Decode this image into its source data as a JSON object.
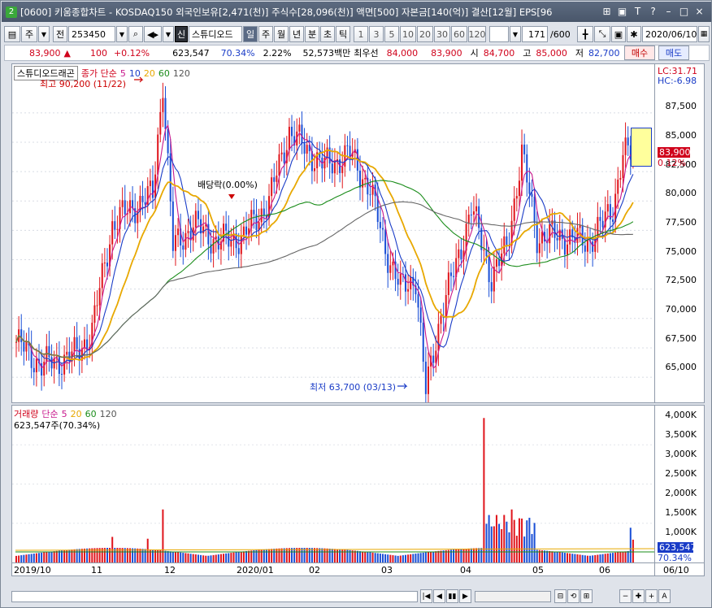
{
  "window": {
    "title": "[0600] 키움종합차트 - KOSDAQ150 외국인보유[2,471(천)] 주식수[28,096(천)] 액면[500] 자본금[140(억)] 결산[12월] EPS[96",
    "badge": "2",
    "controls": [
      "⊞",
      "▣",
      "T",
      "?",
      "–",
      "□",
      "×"
    ]
  },
  "toolbar": {
    "period_label": "주",
    "prev_label": "전",
    "code": "253450",
    "shin_label": "신",
    "stock_name": "스튜디오드",
    "tf_buttons": [
      "일",
      "주",
      "월",
      "년",
      "분",
      "초",
      "틱"
    ],
    "tf_active": "일",
    "nums": [
      "1",
      "3",
      "5",
      "10",
      "20",
      "30",
      "60",
      "120"
    ],
    "count": "171",
    "count_total": "/600",
    "date": "2020/06/10"
  },
  "quote": {
    "price": "83,900",
    "change": "100",
    "change_pct": "+0.12%",
    "volume": "623,547",
    "vol_ratio": "70.34%",
    "turnover": "2.22%",
    "amount": "52,573백만",
    "bid_label": "최우선",
    "bid1": "84,000",
    "bid2": "83,900",
    "open_label": "시",
    "open": "84,700",
    "high_label": "고",
    "high": "85,000",
    "low_label": "저",
    "low": "82,700",
    "buy_label": "매수",
    "sell_label": "매도"
  },
  "price_panel": {
    "stock_label": "스튜디오드래곤",
    "legend_prefix": "종가 단순",
    "ma_labels": [
      "5",
      "10",
      "20",
      "60",
      "120"
    ],
    "ma_colors": [
      "#c8188c",
      "#1a3cc7",
      "#e8a800",
      "#1a8c1a",
      "#555555"
    ],
    "lc": "LC:31.71",
    "hc": "HC:-6.98",
    "high_note": "최고 90,200 (11/22)",
    "low_note": "최저 63,700 (03/13)",
    "dividend_note": "배당락(0.00%)",
    "last_price": "83,900",
    "last_pct": "0.12%"
  },
  "volume_panel": {
    "legend_label": "거래량",
    "legend_prefix": "단순",
    "ma_labels": [
      "5",
      "20",
      "60",
      "120"
    ],
    "ma_colors": [
      "#c8188c",
      "#e8a800",
      "#1a8c1a",
      "#555555"
    ],
    "value_label": "623,547주(70.34%)",
    "last_vol": "623,547",
    "last_pct": "70.34%"
  },
  "x_axis": {
    "labels": [
      "2019/10",
      "11",
      "12",
      "2020/01",
      "02",
      "03",
      "04",
      "05",
      "06",
      "06/10"
    ]
  },
  "chart_data": [
    {
      "type": "candlestick",
      "title": "스튜디오드래곤",
      "ylim": [
        63000,
        91500
      ],
      "y_ticks": [
        "87,500",
        "85,000",
        "82,500",
        "80,000",
        "77,500",
        "75,000",
        "72,500",
        "70,000",
        "67,500",
        "65,000"
      ],
      "high": 90200,
      "low": 63700,
      "last": 83900
    },
    {
      "type": "bar",
      "title": "거래량",
      "ylim": [
        0,
        4200000
      ],
      "y_ticks": [
        "4,000K",
        "3,500K",
        "3,000K",
        "2,500K",
        "2,000K",
        "1,500K",
        "1,000K"
      ],
      "last": 623547
    }
  ]
}
